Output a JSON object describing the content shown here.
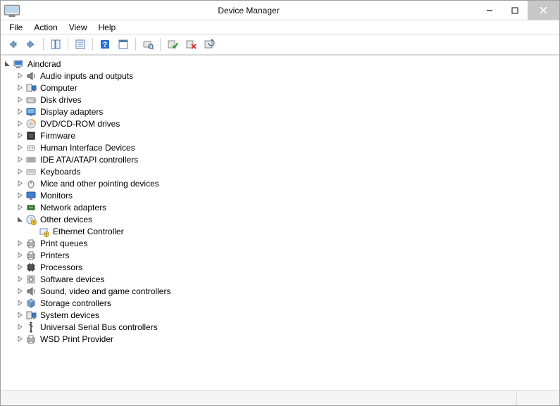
{
  "window": {
    "title": "Device Manager"
  },
  "menu": {
    "file": "File",
    "action": "Action",
    "view": "View",
    "help": "Help"
  },
  "tree": {
    "root": "Aindcrad",
    "audio": "Audio inputs and outputs",
    "computer": "Computer",
    "disk": "Disk drives",
    "display": "Display adapters",
    "dvd": "DVD/CD-ROM drives",
    "firmware": "Firmware",
    "hid": "Human Interface Devices",
    "ide": "IDE ATA/ATAPI controllers",
    "keyboards": "Keyboards",
    "mice": "Mice and other pointing devices",
    "monitors": "Monitors",
    "network": "Network adapters",
    "other": "Other devices",
    "other_child": "Ethernet Controller",
    "printq": "Print queues",
    "printers": "Printers",
    "processors": "Processors",
    "software": "Software devices",
    "sound": "Sound, video and game controllers",
    "storage": "Storage controllers",
    "system": "System devices",
    "usb": "Universal Serial Bus controllers",
    "wsd": "WSD Print Provider"
  }
}
